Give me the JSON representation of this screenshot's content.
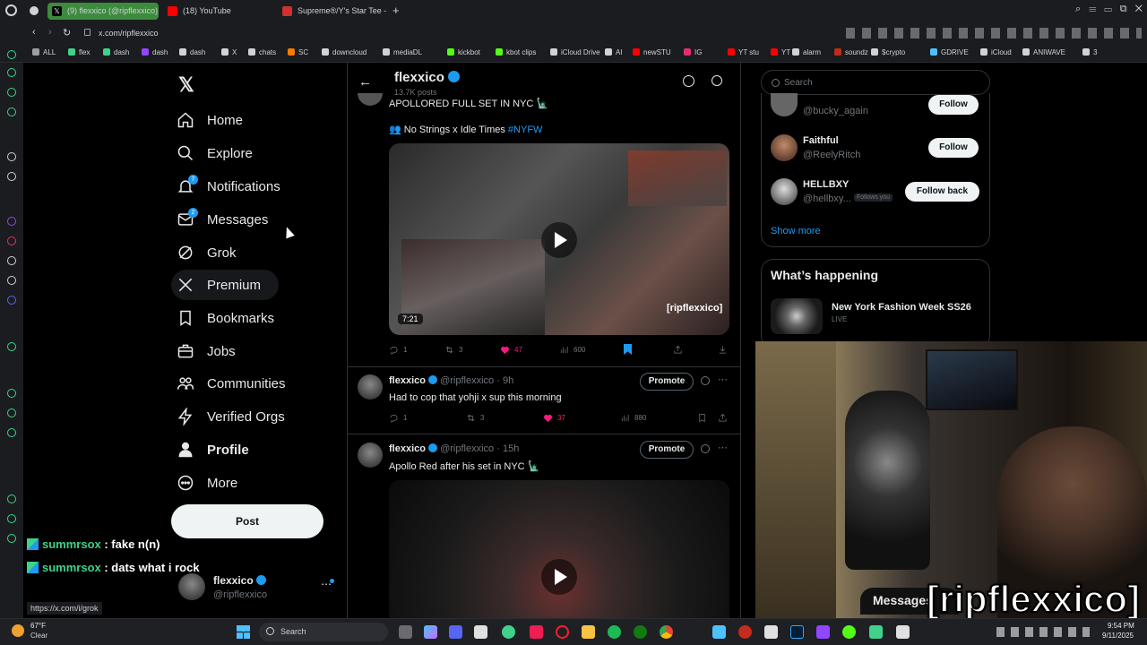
{
  "browser": {
    "tabs": [
      {
        "label": "(9) flexxico (@ripflexxico) / X",
        "active": true
      },
      {
        "label": "(18) YouTube",
        "active": false
      },
      {
        "label": "Supreme®/Y's Star Tee - ...",
        "active": false
      }
    ],
    "url": "x.com/ripflexxico",
    "bookmarks": [
      "ALL",
      "flex",
      "dash",
      "dash",
      "dash",
      "X",
      "chats",
      "SC",
      "downcloud",
      "mediaDL",
      "kickbot",
      "kbot clips",
      "iCloud Drive",
      "AI",
      "newSTU",
      "IG",
      "YT stu",
      "YT",
      "alarm",
      "soundz",
      "$crypto",
      "GDRIVE",
      "iCloud",
      "ANIWAVE",
      "3"
    ]
  },
  "nav": {
    "items": [
      {
        "label": "Home",
        "icon": "home-icon"
      },
      {
        "label": "Explore",
        "icon": "search-icon"
      },
      {
        "label": "Notifications",
        "icon": "bell-icon",
        "badge": "7"
      },
      {
        "label": "Messages",
        "icon": "envelope-icon",
        "badge": "2"
      },
      {
        "label": "Grok",
        "icon": "grok-icon"
      },
      {
        "label": "Premium",
        "icon": "x-logo-icon"
      },
      {
        "label": "Bookmarks",
        "icon": "bookmark-icon"
      },
      {
        "label": "Jobs",
        "icon": "briefcase-icon"
      },
      {
        "label": "Communities",
        "icon": "people-icon"
      },
      {
        "label": "Verified Orgs",
        "icon": "lightning-icon"
      },
      {
        "label": "Profile",
        "icon": "person-icon"
      },
      {
        "label": "More",
        "icon": "more-circle-icon"
      }
    ],
    "post_label": "Post",
    "account": {
      "name": "flexxico",
      "handle": "@ripflexxico"
    }
  },
  "chat": [
    {
      "user": "summrsox",
      "msg": " : fake n(n)"
    },
    {
      "user": "summrsox",
      "msg": " : dats what i rock"
    }
  ],
  "status_url": "https://x.com/i/grok",
  "profile_header": {
    "name": "flexxico",
    "posts": "13.7K posts"
  },
  "tweets": [
    {
      "text": "APOLLORED FULL SET IN NYC 🗽",
      "quote": "👥 No Strings x Idle Times",
      "hashtag": "#NYFW",
      "duration": "7:21",
      "watermark": "[ripflexxico]",
      "replies": "1",
      "reposts": "3",
      "likes": "47",
      "views": "600"
    },
    {
      "name": "flexxico",
      "handle": "@ripflexxico",
      "time": "9h",
      "text": "Had to cop that yohji x sup this morning",
      "promote": "Promote",
      "replies": "1",
      "reposts": "3",
      "likes": "37",
      "views": "880"
    },
    {
      "name": "flexxico",
      "handle": "@ripflexxico",
      "time": "15h",
      "text": "Apollo Red after his set in NYC 🗽",
      "promote": "Promote"
    }
  ],
  "right": {
    "search_placeholder": "Search",
    "who_to_follow": [
      {
        "name": "",
        "handle": "@bucky_again",
        "button": "Follow"
      },
      {
        "name": "Faithful",
        "handle": "@ReelyRitch",
        "button": "Follow"
      },
      {
        "name": "HELLBXY",
        "handle": "@hellbxy...",
        "follows_you": "Follows you",
        "button": "Follow back"
      }
    ],
    "show_more": "Show more",
    "whats_happening_title": "What’s happening",
    "trend": {
      "title": "New York Fashion Week SS26",
      "status": "LIVE"
    }
  },
  "overlay": {
    "messages_label": "Messages",
    "watermark": "[ripflexxico]"
  },
  "taskbar": {
    "weather_temp": "67°F",
    "weather_desc": "Clear",
    "search": "Search",
    "time": "9:54 PM",
    "date": "9/11/2025"
  },
  "colors": {
    "accent": "#1d9bf0",
    "like": "#f91880",
    "tab_active": "#3d8b3d"
  }
}
